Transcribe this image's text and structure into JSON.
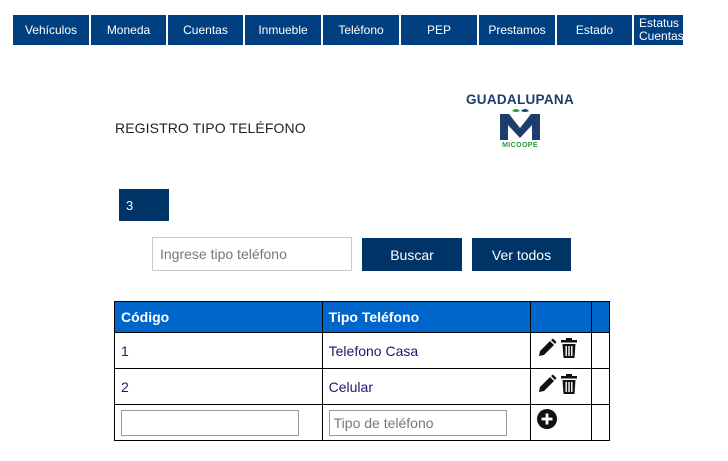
{
  "nav": [
    {
      "label": "Vehículos",
      "w": 66
    },
    {
      "label": "Moneda",
      "w": 77
    },
    {
      "label": "Cuentas",
      "w": 77
    },
    {
      "label": "Inmueble",
      "w": 77
    },
    {
      "label": "Teléfono",
      "w": 78
    },
    {
      "label": "PEP",
      "w": 78
    },
    {
      "label": "Prestamos",
      "w": 77
    },
    {
      "label": "Estado",
      "w": 77
    },
    {
      "label": "Estatus Cuentas",
      "w": 50
    }
  ],
  "page": {
    "title": "REGISTRO TIPO TELÉFONO"
  },
  "logo": {
    "name": "GUADALUPANA",
    "sub": "MICOOPE"
  },
  "selector": {
    "value": "3"
  },
  "search": {
    "placeholder": "Ingrese tipo teléfono",
    "value": ""
  },
  "buttons": {
    "search": "Buscar",
    "show_all": "Ver todos"
  },
  "table": {
    "headers": [
      "Código",
      "Tipo Teléfono",
      "",
      ""
    ],
    "rows": [
      {
        "code": "1",
        "type": "Telefono Casa"
      },
      {
        "code": "2",
        "type": "Celular"
      }
    ],
    "new_row": {
      "code_placeholder": "",
      "type_placeholder": "Tipo de teléfono"
    }
  },
  "colors": {
    "nav": "#004080",
    "button": "#003366",
    "header": "#0066cc",
    "cell_text": "#1a1a66"
  },
  "icons": {
    "edit": "pencil-icon",
    "delete": "trash-icon",
    "add": "plus-circle-icon"
  }
}
